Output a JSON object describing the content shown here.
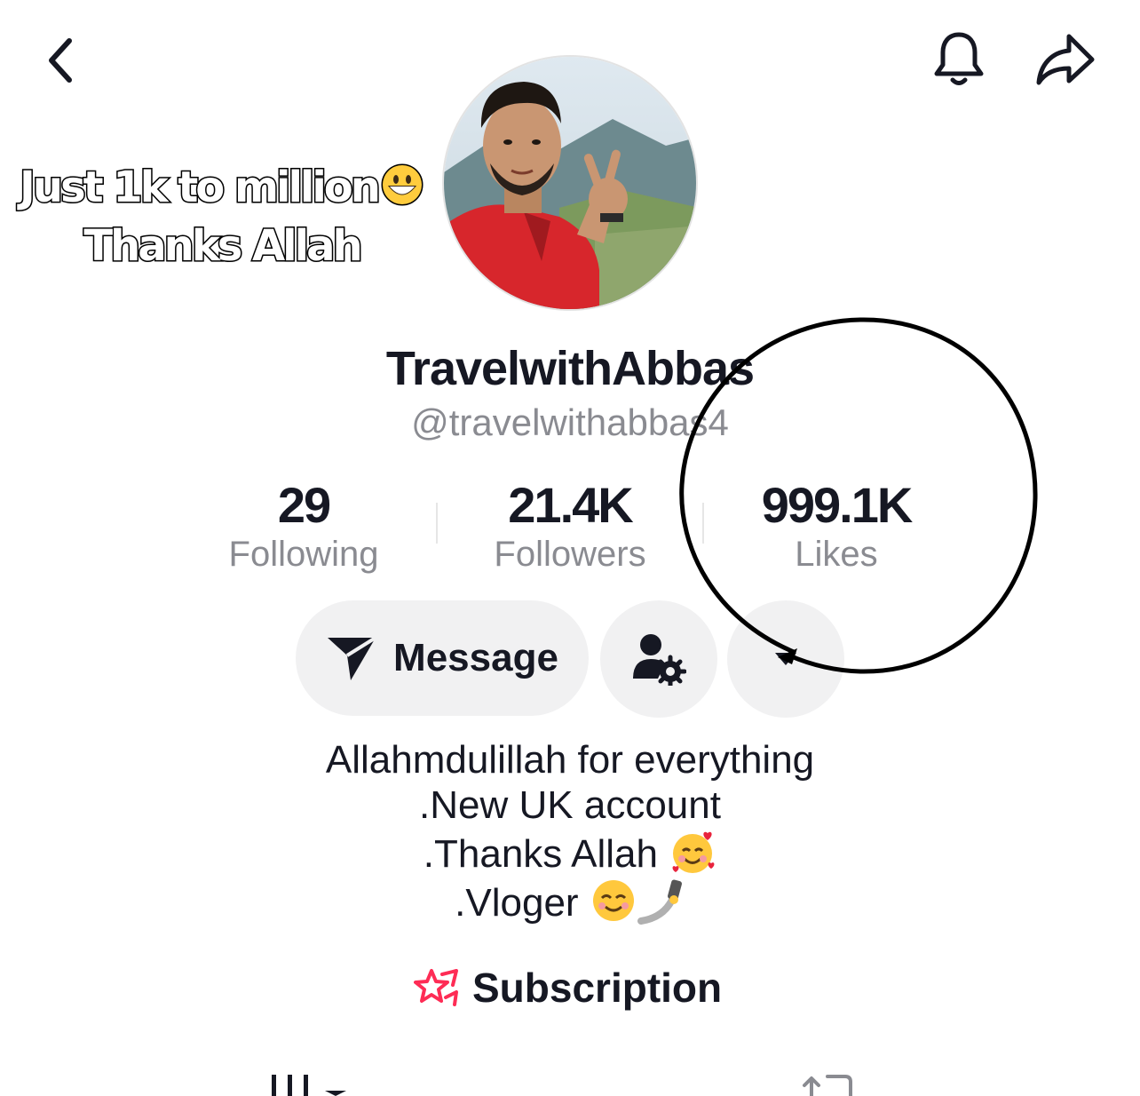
{
  "overlay": {
    "caption_line1": "Just 1k to million",
    "caption_line2": "Thanks Allah"
  },
  "profile": {
    "display_name": "TravelwithAbbas",
    "handle": "@travelwithabbas4"
  },
  "stats": [
    {
      "value": "29",
      "label": "Following"
    },
    {
      "value": "21.4K",
      "label": "Followers"
    },
    {
      "value": "999.1K",
      "label": "Likes"
    }
  ],
  "actions": {
    "message_label": "Message"
  },
  "bio": {
    "line1": "Allahmdulillah for everything",
    "line2": ".New UK account",
    "line3": ".Thanks Allah",
    "line4": ".Vloger"
  },
  "subscription": {
    "label": "Subscription"
  },
  "colors": {
    "text": "#161823",
    "secondary_text": "#8a8b91",
    "button_bg": "#f1f1f2",
    "accent_pink": "#fe2c55"
  },
  "icons": {
    "back": "chevron-left-icon",
    "notifications": "bell-icon",
    "share": "share-arrow-icon",
    "message": "send-icon",
    "follow_settings": "user-gear-icon",
    "suggested": "caret-down-icon",
    "subscription": "star-icon"
  }
}
